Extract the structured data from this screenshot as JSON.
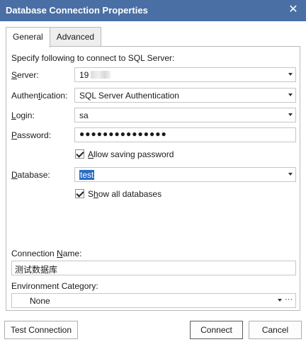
{
  "window": {
    "title": "Database Connection Properties",
    "close_glyph": "✕"
  },
  "tabs": [
    {
      "label": "General"
    },
    {
      "label": "Advanced"
    }
  ],
  "general": {
    "instruction": "Specify following to connect to SQL Server:",
    "server": {
      "label_ul": "S",
      "label_rest": "erver:",
      "value_visible": "19"
    },
    "authentication": {
      "label_pre": "Authen",
      "label_ul": "t",
      "label_post": "ication:",
      "value": "SQL Server Authentication"
    },
    "login": {
      "label_ul": "L",
      "label_rest": "ogin:",
      "value": "sa"
    },
    "password": {
      "label_ul": "P",
      "label_rest": "assword:",
      "value": "●●●●●●●●●●●●●●●"
    },
    "allow_saving": {
      "label_ul": "A",
      "label_rest": "llow saving password",
      "checked": true
    },
    "database": {
      "label_ul": "D",
      "label_rest": "atabase:",
      "value": "test"
    },
    "show_all": {
      "label_pre": "S",
      "label_ul": "h",
      "label_post": "ow all databases",
      "checked": true
    },
    "connection_name": {
      "label_pre": "Connection ",
      "label_ul": "N",
      "label_post": "ame:",
      "value": "测试数据库"
    },
    "environment": {
      "label": "Environment Category:",
      "value": "None",
      "more": "···"
    }
  },
  "buttons": {
    "test": "Test Connection",
    "connect": "Connect",
    "cancel": "Cancel"
  }
}
